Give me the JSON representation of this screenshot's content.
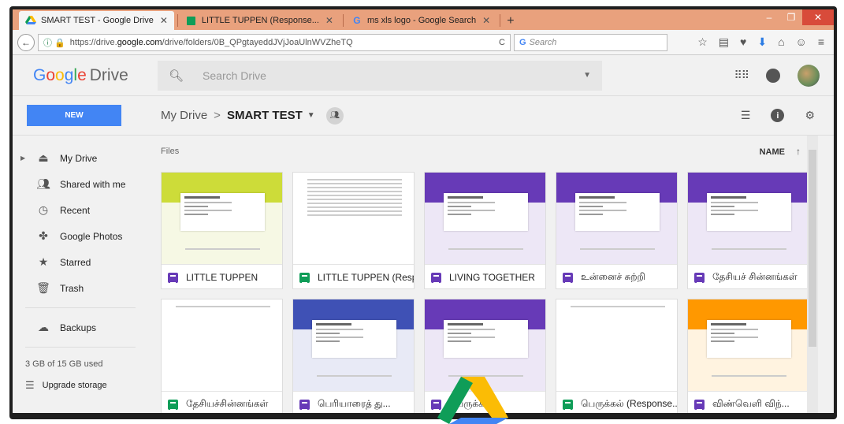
{
  "browser": {
    "tabs": [
      {
        "label": "SMART TEST - Google Drive",
        "icon": "google-drive-icon",
        "active": true
      },
      {
        "label": "LITTLE TUPPEN (Response...",
        "icon": "google-sheets-icon",
        "active": false
      },
      {
        "label": "ms xls logo - Google Search",
        "icon": "google-g-icon",
        "active": false
      }
    ],
    "url_prefix": "https://drive.",
    "url_domain": "google.com",
    "url_path": "/drive/folders/0B_QPgtayeddJVjJoaUlnWVZheTQ",
    "search_placeholder": "Search"
  },
  "drive": {
    "logo_google": [
      "G",
      "o",
      "o",
      "g",
      "l",
      "e"
    ],
    "logo_drive": "Drive",
    "search_placeholder": "Search Drive",
    "new_label": "NEW",
    "breadcrumb_root": "My Drive",
    "breadcrumb_sep": ">",
    "breadcrumb_current": "SMART TEST"
  },
  "sidebar": {
    "items": [
      {
        "label": "My Drive",
        "icon": "my-drive-icon"
      },
      {
        "label": "Shared with me",
        "icon": "shared-people-icon"
      },
      {
        "label": "Recent",
        "icon": "clock-icon"
      },
      {
        "label": "Google Photos",
        "icon": "pinwheel-icon"
      },
      {
        "label": "Starred",
        "icon": "star-icon"
      },
      {
        "label": "Trash",
        "icon": "trash-icon"
      },
      {
        "label": "Backups",
        "icon": "cloud-icon"
      }
    ],
    "storage": "3 GB of 15 GB used",
    "upgrade": "Upgrade storage"
  },
  "main": {
    "section_label": "Files",
    "sort_label": "NAME",
    "files": [
      {
        "name": "LITTLE TUPPEN",
        "type": "form",
        "color": "#cddc39",
        "bg": "#f6f8e4"
      },
      {
        "name": "LITTLE TUPPEN (Respo...",
        "type": "sheet",
        "color": "#ffffff",
        "bg": "#ffffff"
      },
      {
        "name": "LIVING TOGETHER",
        "type": "form",
        "color": "#673ab7",
        "bg": "#ede7f6"
      },
      {
        "name": "உன்னைச் சுற்றி",
        "type": "form",
        "color": "#673ab7",
        "bg": "#ede7f6"
      },
      {
        "name": "தேசியச் சின்னங்கள்",
        "type": "form",
        "color": "#673ab7",
        "bg": "#ede7f6"
      },
      {
        "name": "தேசியச்சின்னங்கள்",
        "type": "sheet",
        "color": "#ffffff",
        "bg": "#ffffff"
      },
      {
        "name": "பெரியாரைத் து...",
        "type": "form",
        "color": "#3f51b5",
        "bg": "#e8eaf6"
      },
      {
        "name": "பெருக்கல்",
        "type": "form",
        "color": "#673ab7",
        "bg": "#ede7f6"
      },
      {
        "name": "பெருக்கல் (Response...",
        "type": "sheet",
        "color": "#ffffff",
        "bg": "#ffffff"
      },
      {
        "name": "விண்வெளி விந்...",
        "type": "form",
        "color": "#ff9800",
        "bg": "#fff3e0"
      }
    ]
  }
}
